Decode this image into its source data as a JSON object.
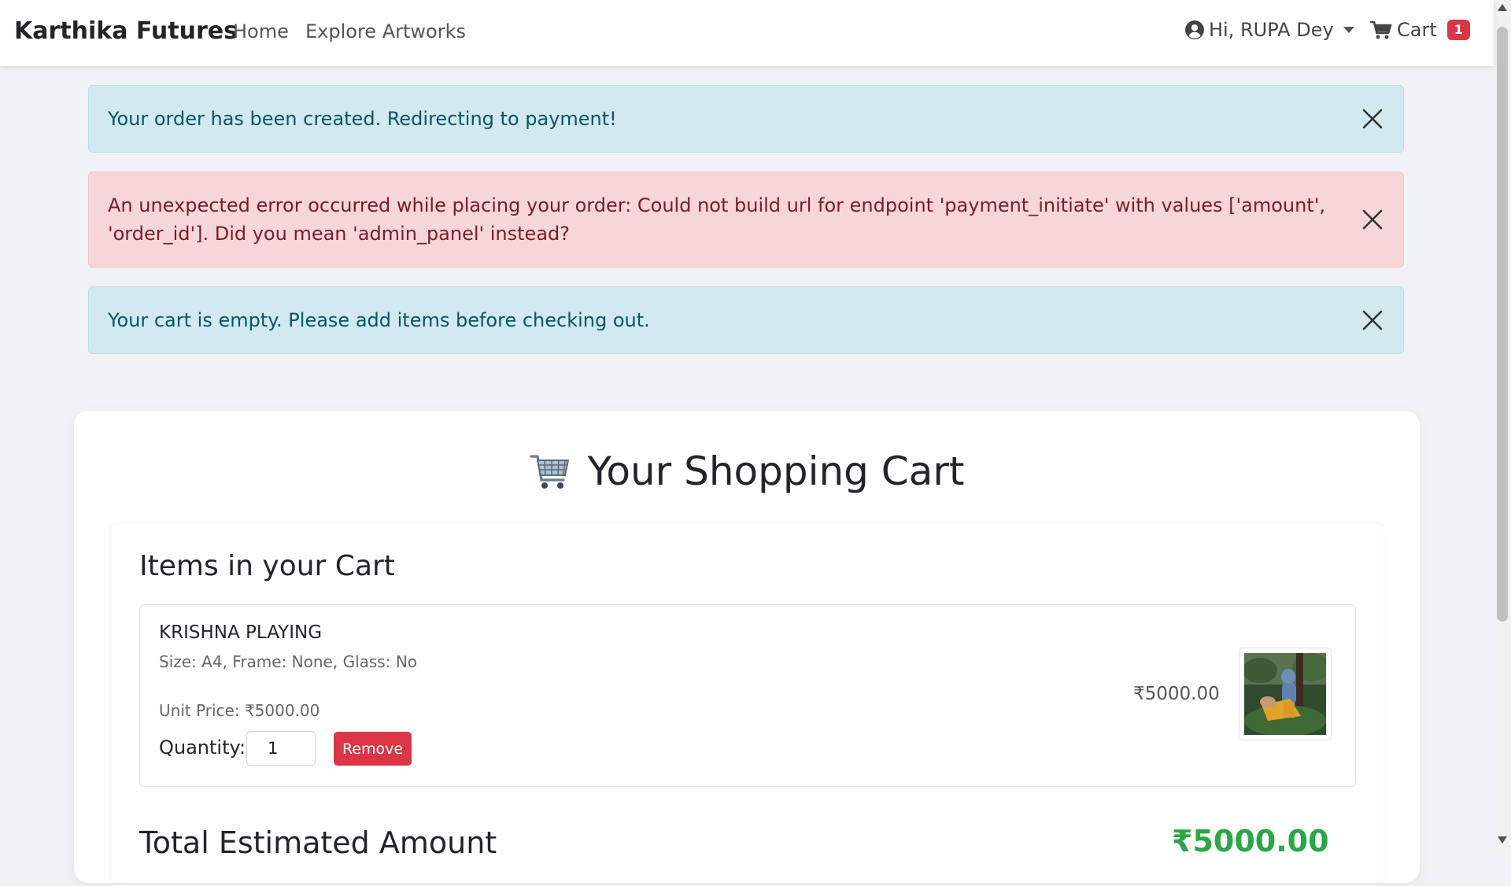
{
  "navbar": {
    "brand": "Karthika Futures",
    "links": [
      "Home",
      "Explore Artworks"
    ],
    "user_greeting": "Hi, RUPA Dey",
    "cart_label": "Cart",
    "cart_count": "1"
  },
  "alerts": [
    {
      "type": "info",
      "text": "Your order has been created. Redirecting to payment!"
    },
    {
      "type": "danger",
      "text": "An unexpected error occurred while placing your order: Could not build url for endpoint 'payment_initiate' with values ['amount', 'order_id']. Did you mean 'admin_panel' instead?"
    },
    {
      "type": "info",
      "text": "Your cart is empty. Please add items before checking out."
    }
  ],
  "cart": {
    "title": "Your Shopping Cart",
    "items_heading": "Items in your Cart",
    "items": [
      {
        "name": "KRISHNA PLAYING",
        "details": "Size: A4, Frame: None, Glass: No",
        "unit_price": "Unit Price: ₹5000.00",
        "quantity_label": "Quantity:",
        "quantity": "1",
        "remove_label": "Remove",
        "line_total": "₹5000.00"
      }
    ],
    "total_label": "Total Estimated Amount",
    "total_value": "₹5000.00"
  },
  "colors": {
    "info_bg": "#d1e9ef",
    "danger_bg": "#f7d6da",
    "remove_button": "#dc3545",
    "total_green": "#28a745",
    "badge_red": "#dc3545"
  },
  "icons": {
    "user": "user-circle-icon",
    "cart": "shopping-cart-icon",
    "close": "close-icon",
    "title_emoji": "shopping-cart-emoji-icon"
  }
}
